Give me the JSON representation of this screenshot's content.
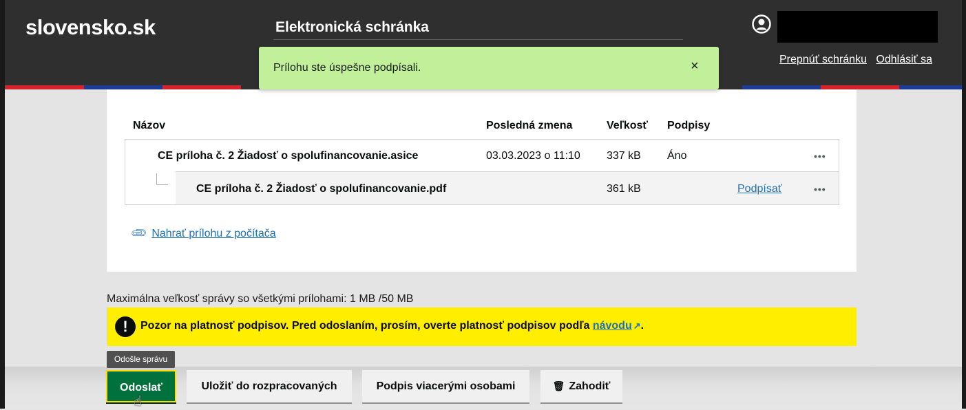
{
  "header": {
    "logo": "slovensko.sk",
    "app_title": "Elektronická schránka",
    "links": [
      "Prepnúť schránku",
      "Odhlásiť sa"
    ]
  },
  "toast": {
    "message": "Prílohu ste úspešne podpísali.",
    "close_icon": "×"
  },
  "table": {
    "columns": [
      "Názov",
      "Posledná zmena",
      "Veľkosť",
      "Podpisy"
    ],
    "rows": [
      {
        "name": "CE príloha č. 2 Žiadosť o spolufinancovanie.asice",
        "modified": "03.03.2023 o 11:10",
        "size": "337 kB",
        "signatures": "Áno",
        "action": "",
        "more": "•••"
      },
      {
        "name": "CE príloha č. 2 Žiadosť o spolufinancovanie.pdf",
        "modified": "",
        "size": "361 kB",
        "signatures": "",
        "action": "Podpísať",
        "more": "•••"
      }
    ]
  },
  "upload_link": "Nahrať prílohu z počítača",
  "max_size_text": "Maximálna veľkosť správy so všetkými prílohami: 1 MB /50 MB",
  "warning": {
    "text": "Pozor na platnosť podpisov. Pred odoslaním, prosím, overte platnosť podpisov podľa",
    "link": "návodu",
    "suffix": "."
  },
  "tooltip": "Odošle správu",
  "actions": {
    "send": "Odoslať",
    "save_draft": "Uložiť do rozpracovaných",
    "multi_sign": "Podpis viacerými osobami",
    "discard": "Zahodiť"
  },
  "colors": {
    "header_bg": "#2f2f2f",
    "toast_bg": "#c2f09a",
    "warning_bg": "#ffee00",
    "primary_button": "#00703c",
    "link": "#1d70b8"
  },
  "icons": [
    "user-icon",
    "close-icon",
    "more-icon",
    "paperclip-icon",
    "warning-icon",
    "external-link-icon",
    "trash-icon",
    "pointer-cursor-icon"
  ]
}
